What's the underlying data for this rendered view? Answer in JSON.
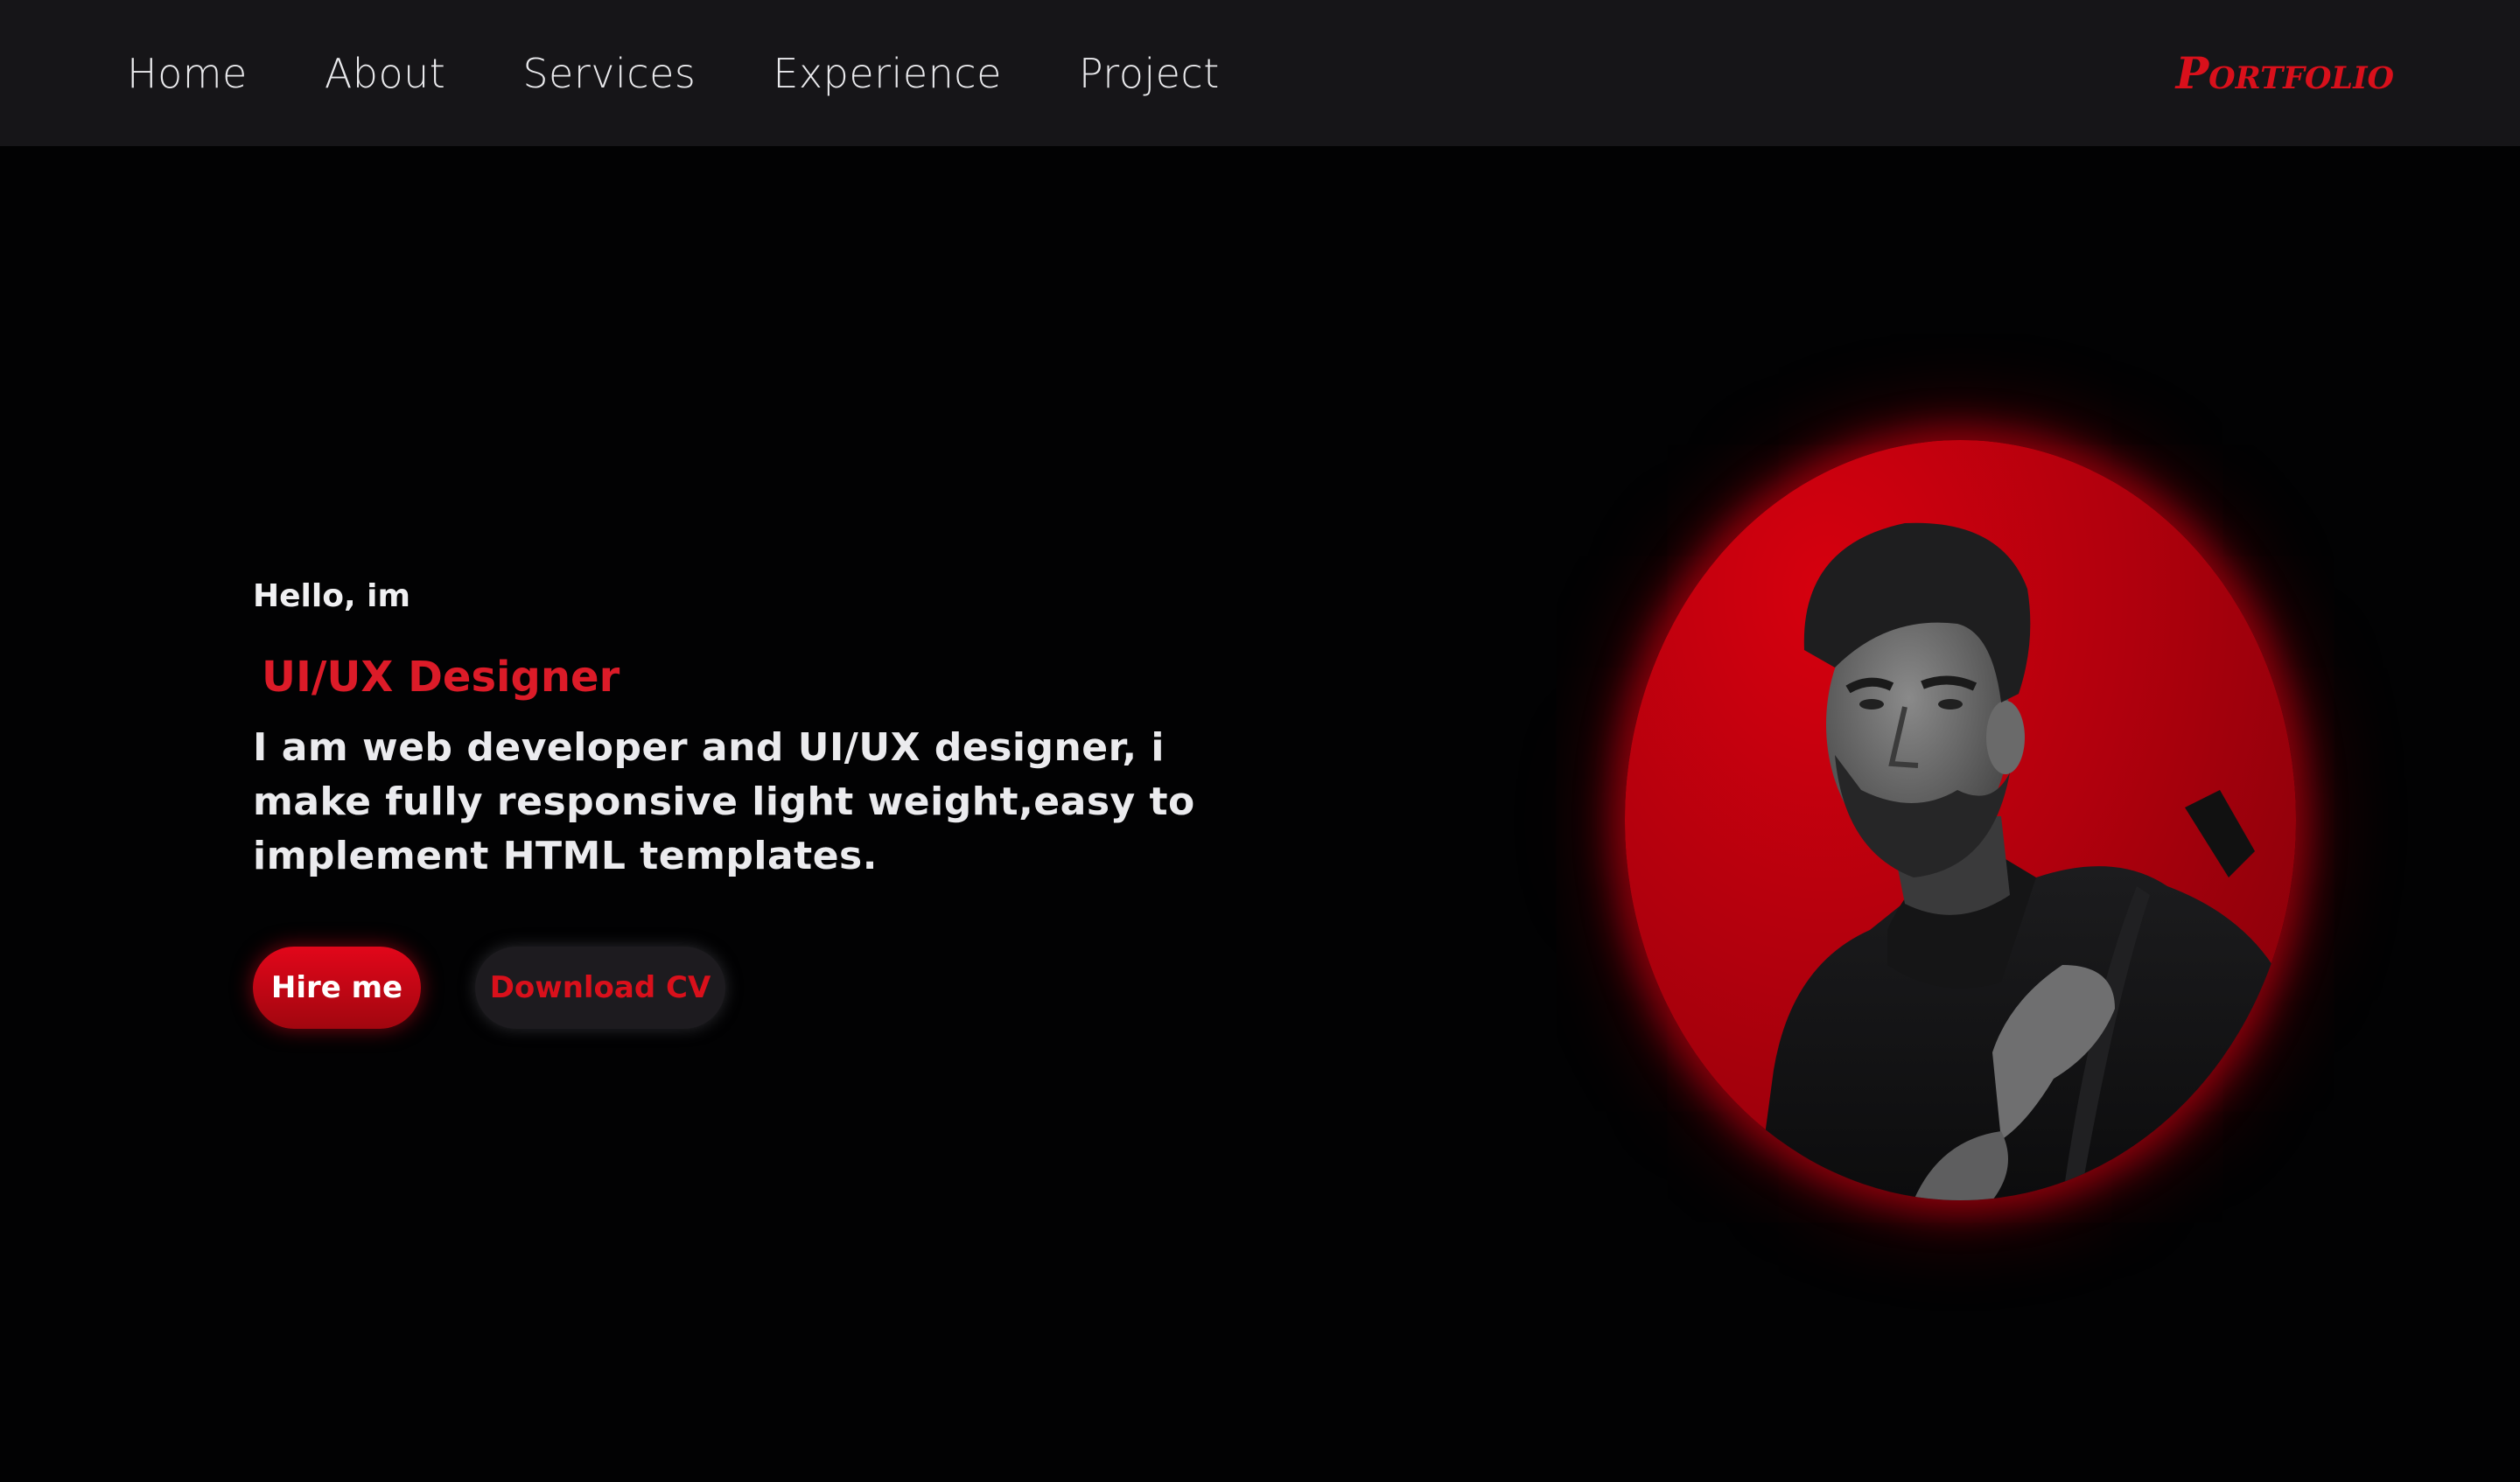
{
  "nav": {
    "items": [
      {
        "label": "Home"
      },
      {
        "label": "About"
      },
      {
        "label": "Services"
      },
      {
        "label": "Experience"
      },
      {
        "label": "Project"
      }
    ],
    "brand": "Portfolio"
  },
  "hero": {
    "greeting": "Hello, im",
    "role": "UI/UX Designer",
    "description": "I am web developer and UI/UX designer, i make fully responsive light weight,easy to implement HTML templates.",
    "hire_label": "Hire me",
    "cv_label": "Download CV"
  },
  "colors": {
    "accent": "#dc1b28",
    "background": "#020203",
    "navbar": "#161518"
  }
}
